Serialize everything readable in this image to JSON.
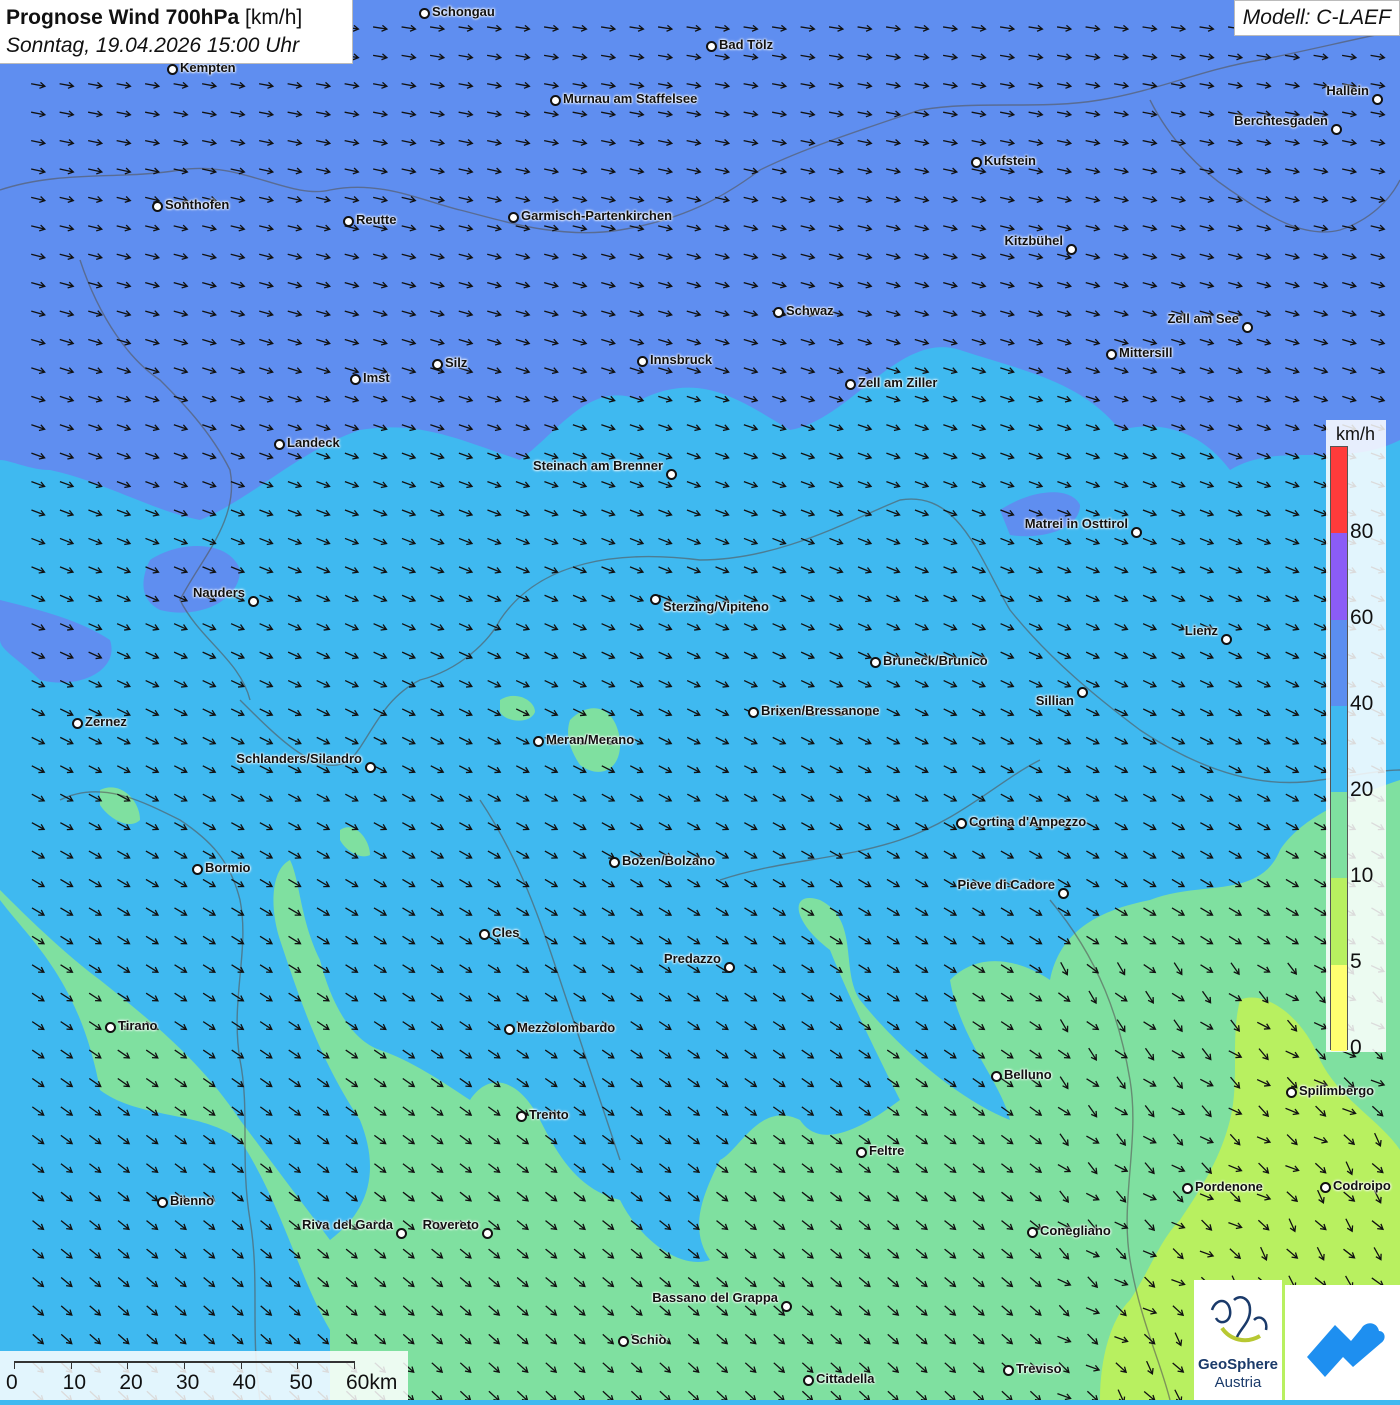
{
  "title": {
    "main": "Prognose Wind 700hPa",
    "unit": "[km/h]",
    "date": "Sonntag, 19.04.2026 15:00 Uhr"
  },
  "model": "Modell: C-LAEF",
  "legend": {
    "unit": "km/h",
    "labels": [
      "80",
      "60",
      "40",
      "20",
      "10",
      "5",
      "0"
    ],
    "colors": [
      "#ff3b3b",
      "#8b5cf6",
      "#5b8ef0",
      "#3fb9f0",
      "#7fe0a0",
      "#b8f060",
      "#ffff70"
    ]
  },
  "scale": {
    "labels": [
      "0",
      "10",
      "20",
      "30",
      "40",
      "50",
      "60km"
    ]
  },
  "logo": {
    "name": "GeoSphere",
    "sub": "Austria"
  },
  "cities": [
    {
      "name": "Schongau"
    },
    {
      "name": "Bad Tölz"
    },
    {
      "name": "Kempten"
    },
    {
      "name": "Murnau am Staffelsee"
    },
    {
      "name": "Hallein"
    },
    {
      "name": "Berchtesgaden"
    },
    {
      "name": "Kufstein"
    },
    {
      "name": "Sonthofen"
    },
    {
      "name": "Reutte"
    },
    {
      "name": "Garmisch-Partenkirchen"
    },
    {
      "name": "Kitzbühel"
    },
    {
      "name": "Schwaz"
    },
    {
      "name": "Zell am See"
    },
    {
      "name": "Innsbruck"
    },
    {
      "name": "Mittersill"
    },
    {
      "name": "Silz"
    },
    {
      "name": "Imst"
    },
    {
      "name": "Zell am Ziller"
    },
    {
      "name": "Landeck"
    },
    {
      "name": "Steinach am Brenner"
    },
    {
      "name": "Matrei in Osttirol"
    },
    {
      "name": "Nauders"
    },
    {
      "name": "Sterzing/Vipiteno"
    },
    {
      "name": "Lienz"
    },
    {
      "name": "Bruneck/Brunico"
    },
    {
      "name": "Sillian"
    },
    {
      "name": "Zernez"
    },
    {
      "name": "Brixen/Bressanone"
    },
    {
      "name": "Meran/Merano"
    },
    {
      "name": "Schlanders/Silandro"
    },
    {
      "name": "Cortina d'Ampezzo"
    },
    {
      "name": "Bormio"
    },
    {
      "name": "Bozen/Bolzano"
    },
    {
      "name": "Pieve di Cadore"
    },
    {
      "name": "Cles"
    },
    {
      "name": "Predazzo"
    },
    {
      "name": "Tirano"
    },
    {
      "name": "Mezzolombardo"
    },
    {
      "name": "Belluno"
    },
    {
      "name": "Spilimbergo"
    },
    {
      "name": "Trento"
    },
    {
      "name": "Feltre"
    },
    {
      "name": "Bienno"
    },
    {
      "name": "Pordenone"
    },
    {
      "name": "Codroipo"
    },
    {
      "name": "Riva del Garda"
    },
    {
      "name": "Rovereto"
    },
    {
      "name": "Conegliano"
    },
    {
      "name": "Bassano del Grappa"
    },
    {
      "name": "Schio"
    },
    {
      "name": "Treviso"
    },
    {
      "name": "Cittadella"
    }
  ]
}
